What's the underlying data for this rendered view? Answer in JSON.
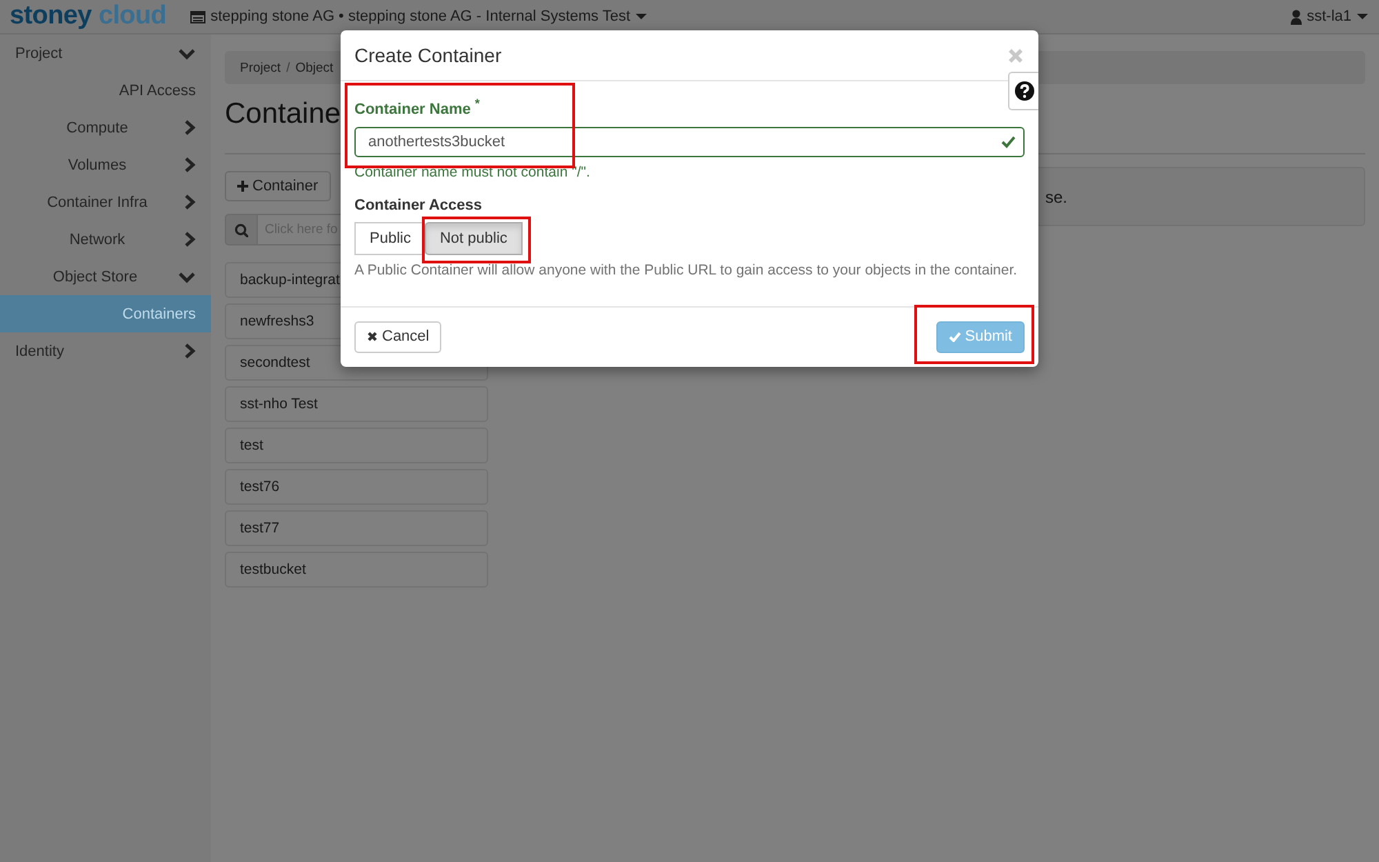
{
  "brand": {
    "name_part_1": "stoney",
    "name_part_2": "cloud"
  },
  "project_selector": {
    "label": "stepping stone AG • stepping stone AG - Internal Systems Test"
  },
  "user_menu": {
    "label": "sst-la1"
  },
  "sidebar": {
    "items": [
      {
        "label": "Project",
        "expanded": true,
        "children": [
          {
            "label": "API Access",
            "selected": false
          },
          {
            "label": "Compute",
            "expanded": false
          },
          {
            "label": "Volumes",
            "expanded": false
          },
          {
            "label": "Container Infra",
            "expanded": false
          },
          {
            "label": "Network",
            "expanded": false
          },
          {
            "label": "Object Store",
            "expanded": true,
            "children": [
              {
                "label": "Containers",
                "selected": true
              }
            ]
          }
        ]
      },
      {
        "label": "Identity",
        "expanded": false
      }
    ]
  },
  "breadcrumb": {
    "items": [
      "Project",
      "Object"
    ],
    "separator": "/"
  },
  "page_title": "Containe",
  "toolbar": {
    "create_button": "Container",
    "search": {
      "placeholder": "Click here fo"
    }
  },
  "containers": [
    "backup-integrat",
    "newfreshs3",
    "secondtest",
    "sst-nho Test",
    "test",
    "test76",
    "test77",
    "testbucket"
  ],
  "alert": {
    "text": "se."
  },
  "modal": {
    "title": "Create Container",
    "name_field": {
      "label": "Container Name",
      "required_mark": "*",
      "value": "anothertests3bucket",
      "valid": true,
      "help": "Container name must not contain \"/\".",
      "highlighted": true
    },
    "access_field": {
      "label": "Container Access",
      "options": [
        {
          "label": "Public",
          "selected": false,
          "highlighted": false
        },
        {
          "label": "Not public",
          "selected": true,
          "highlighted": true
        }
      ],
      "help": "A Public Container will allow anyone with the Public URL to gain access to your objects in the container."
    },
    "cancel_button": {
      "label": "Cancel"
    },
    "submit_button": {
      "label": "Submit",
      "disabled": true,
      "highlighted": true
    }
  }
}
